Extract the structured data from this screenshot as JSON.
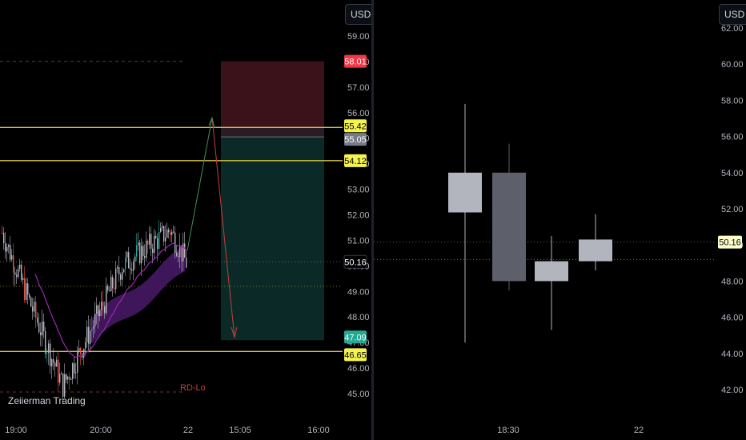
{
  "left_chart": {
    "currency_button": "USD",
    "watermark": "Zeiierman Trading",
    "indicator_label": "RD-Lo",
    "price_axis": [
      "59.00",
      "58.00",
      "57.00",
      "56.00",
      "55.00",
      "54.00",
      "53.00",
      "52.00",
      "51.00",
      "50.00",
      "49.00",
      "48.00",
      "47.00",
      "46.00",
      "45.00"
    ],
    "time_axis": [
      "19:00",
      "20:00",
      "22",
      "15:05",
      "16:00"
    ],
    "tags": [
      {
        "label": "58.01",
        "color": "#f23645",
        "text_color": "#ffffff"
      },
      {
        "label": "55.42",
        "color": "#f5f44f",
        "text_color": "#000000"
      },
      {
        "label": "55.05",
        "color": "#787b86",
        "text_color": "#ffffff"
      },
      {
        "label": "54.12",
        "color": "#f5f44f",
        "text_color": "#000000"
      },
      {
        "label": "50.16",
        "color": "#000000",
        "text_color": "#ffffff"
      },
      {
        "label": "47.09",
        "color": "#22ab94",
        "text_color": "#ffffff"
      },
      {
        "label": "46.65",
        "color": "#f5f44f",
        "text_color": "#000000"
      }
    ],
    "colors": {
      "up": "#26a69a",
      "down": "#ef5350",
      "neutral": "#b2b5be",
      "ema": "#9c27b0",
      "band": "#4a1a6a",
      "level": "#d4c24a",
      "stop": "#3b1219",
      "target": "#0b2a27"
    }
  },
  "right_chart": {
    "currency_button": "USD",
    "price_axis": [
      "62.00",
      "60.00",
      "58.00",
      "56.00",
      "54.00",
      "52.00",
      "50.00",
      "48.00",
      "46.00",
      "44.00",
      "42.00"
    ],
    "time_axis": [
      "18:30",
      "22"
    ],
    "price_tag": "50.16",
    "candles": [
      {
        "open": 54.0,
        "close": 51.8,
        "high": 57.8,
        "low": 44.6,
        "shade": "#b2b5be"
      },
      {
        "open": 54.0,
        "close": 48.0,
        "high": 55.6,
        "low": 47.5,
        "shade": "#5d606b"
      },
      {
        "open": 48.0,
        "close": 49.1,
        "high": 50.5,
        "low": 45.3,
        "shade": "#b2b5be"
      },
      {
        "open": 49.1,
        "close": 50.3,
        "high": 51.7,
        "low": 48.6,
        "shade": "#b2b5be"
      }
    ],
    "colors": {
      "tag_bg": "#ffffcc",
      "tag_text": "#000000"
    }
  }
}
